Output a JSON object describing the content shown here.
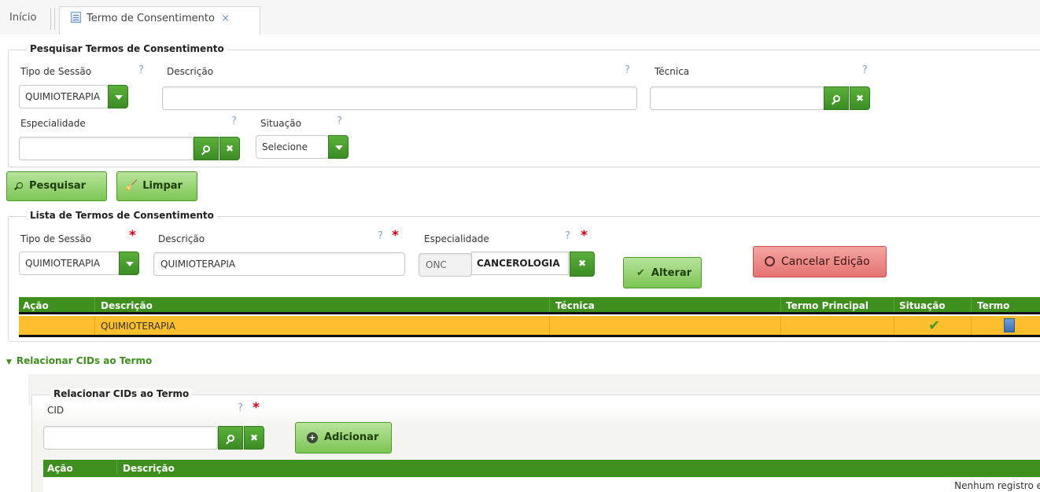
{
  "tabs": {
    "home": "Início",
    "active": "Termo de Consentimento",
    "close": "×"
  },
  "search": {
    "legend": "Pesquisar Termos de Consentimento",
    "tipo_label": "Tipo de Sessão",
    "tipo_value": "QUIMIOTERAPIA",
    "descricao_label": "Descrição",
    "descricao_value": "",
    "tecnica_label": "Técnica",
    "tecnica_value": "",
    "especialidade_label": "Especialidade",
    "especialidade_value": "",
    "situacao_label": "Situação",
    "situacao_value": "Selecione",
    "help": "?"
  },
  "buttons": {
    "pesquisar": "Pesquisar",
    "limpar": "Limpar",
    "alterar": "Alterar",
    "cancelar": "Cancelar Edição",
    "adicionar": "Adicionar"
  },
  "list": {
    "legend": "Lista de Termos de Consentimento",
    "tipo_label": "Tipo de Sessão",
    "tipo_value": "QUIMIOTERAPIA",
    "descricao_label": "Descrição",
    "descricao_value": "QUIMIOTERAPIA",
    "especialidade_label": "Especialidade",
    "especialidade_code": "ONC",
    "especialidade_value": "CANCEROLOGIA",
    "required": "*",
    "columns": [
      "Ação",
      "Descrição",
      "Técnica",
      "Termo Principal",
      "Situação",
      "Termo"
    ],
    "rows": [
      {
        "acao": "",
        "descricao": "QUIMIOTERAPIA",
        "tecnica": "",
        "termo_principal": "",
        "situacao": "check-icon",
        "termo": "document-icon"
      }
    ]
  },
  "cids": {
    "section_toggle": "Relacionar CIDs ao Termo",
    "legend": "Relacionar CIDs ao Termo",
    "cid_label": "CID",
    "cid_value": "",
    "columns": [
      "Ação",
      "Descrição"
    ],
    "empty_text": "Nenhum registro e"
  },
  "colors": {
    "accent_green": "#3e8f1e",
    "row_selected": "#fdbf2d",
    "cancel_red": "#e57373"
  }
}
